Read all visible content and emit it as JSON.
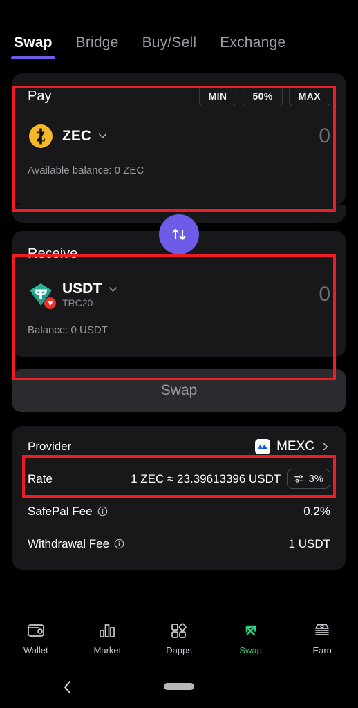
{
  "tabs": [
    {
      "label": "Swap",
      "active": true
    },
    {
      "label": "Bridge",
      "active": false
    },
    {
      "label": "Buy/Sell",
      "active": false
    },
    {
      "label": "Exchange",
      "active": false
    }
  ],
  "pay": {
    "title": "Pay",
    "chips": [
      "MIN",
      "50%",
      "MAX"
    ],
    "asset_symbol": "ZEC",
    "amount": "0",
    "balance": "Available balance: 0 ZEC",
    "icon": "zec-coin-icon"
  },
  "toggle": {
    "icon": "swap-direction-icon",
    "color": "#6c5ce7"
  },
  "receive": {
    "title": "Receive",
    "asset_symbol": "USDT",
    "asset_network": "TRC20",
    "amount": "0",
    "balance": "Balance: 0 USDT",
    "icon": "usdt-tether-icon",
    "badge_icon": "tron-badge-icon"
  },
  "action": {
    "swap_label": "Swap"
  },
  "details": {
    "provider_label": "Provider",
    "provider_value": "MEXC",
    "provider_icon": "mexc-logo-icon",
    "rate_label": "Rate",
    "rate_value": "1 ZEC ≈ 23.39613396 USDT",
    "slippage_value": "3%",
    "slippage_icon": "sliders-icon",
    "safepal_fee_label": "SafePal Fee",
    "safepal_fee_value": "0.2%",
    "withdrawal_fee_label": "Withdrawal Fee",
    "withdrawal_fee_value": "1 USDT"
  },
  "bottom_nav": [
    {
      "label": "Wallet",
      "icon": "wallet-icon",
      "active": false
    },
    {
      "label": "Market",
      "icon": "chart-bars-icon",
      "active": false
    },
    {
      "label": "Dapps",
      "icon": "grid-shapes-icon",
      "active": false
    },
    {
      "label": "Swap",
      "icon": "swap-arrows-icon",
      "active": true
    },
    {
      "label": "Earn",
      "icon": "cash-stack-icon",
      "active": false
    }
  ],
  "colors": {
    "accent_purple": "#6c5ce7",
    "active_green": "#2fd07f",
    "zec_gold": "#f4b728",
    "usdt_teal": "#26a17b",
    "tron_red": "#e8322a",
    "mexc_blue": "#1763ff",
    "annotation_red": "#ee1c25"
  }
}
